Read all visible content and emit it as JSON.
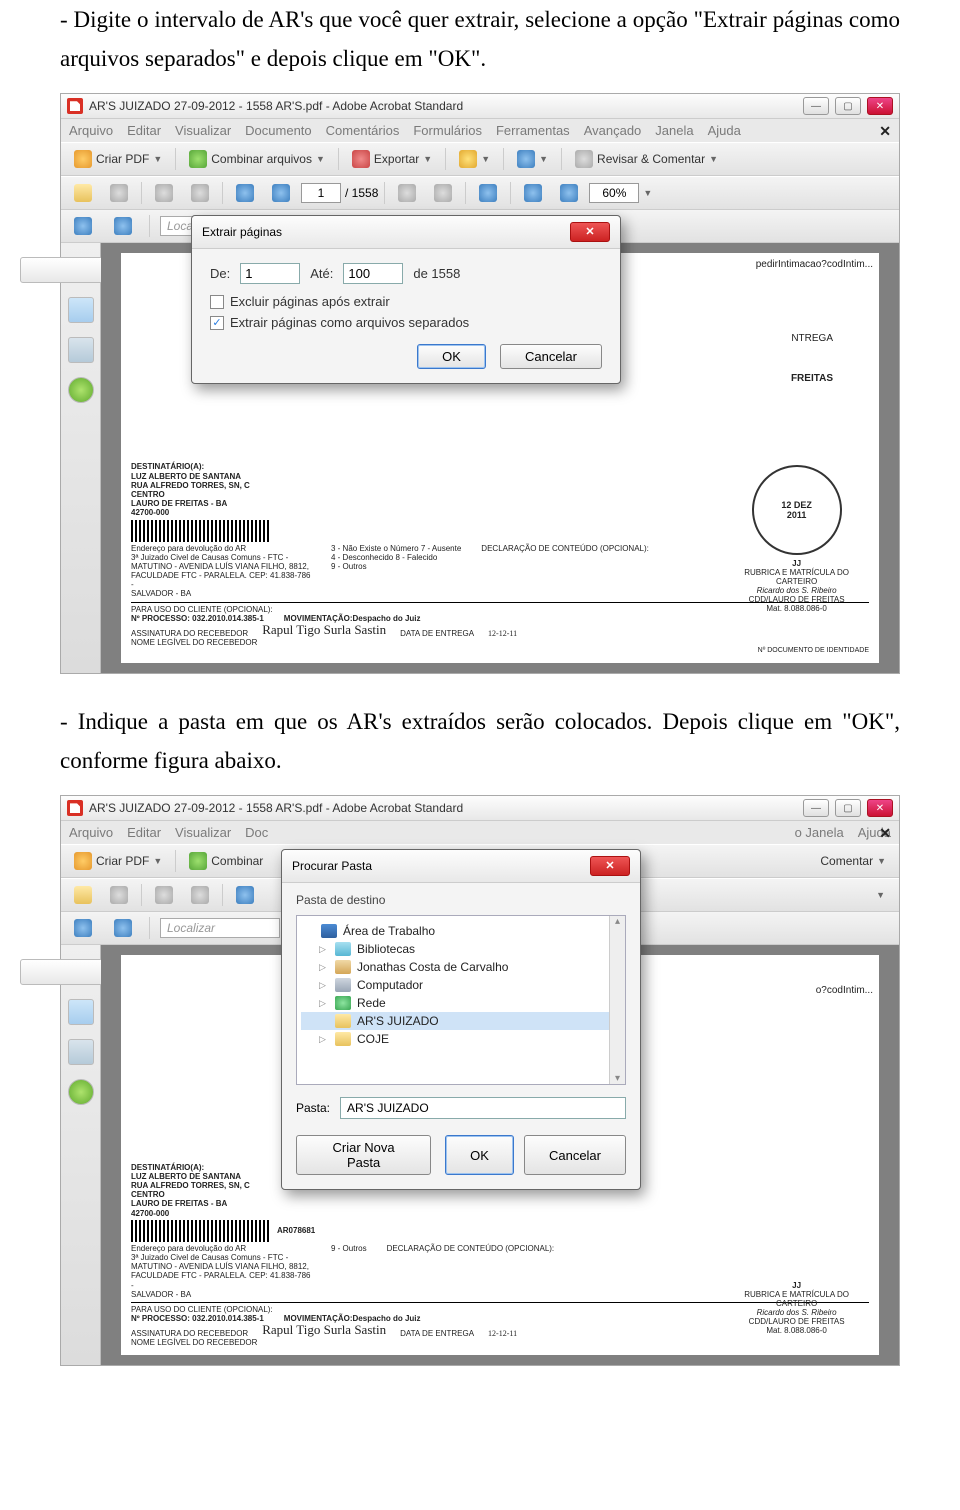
{
  "instructions": {
    "step1": "- Digite o intervalo de AR's que você quer extrair, selecione a opção \"Extrair páginas como arquivos separados\" e depois clique em \"OK\".",
    "step2": "- Indique a pasta em que os AR's extraídos serão colocados. Depois clique em \"OK\", conforme figura abaixo."
  },
  "window": {
    "title": "AR'S JUIZADO 27-09-2012 - 1558 AR'S.pdf - Adobe Acrobat Standard"
  },
  "menu": {
    "items": [
      "Arquivo",
      "Editar",
      "Visualizar",
      "Documento",
      "Comentários",
      "Formulários",
      "Ferramentas",
      "Avançado",
      "Janela",
      "Ajuda"
    ],
    "items_short": [
      "Arquivo",
      "Editar",
      "Visualizar",
      "Doc"
    ],
    "right": "o   Janela"
  },
  "toolbar1": {
    "criar_pdf": "Criar PDF",
    "combinar": "Combinar arquivos",
    "combinar_short": "Combinar",
    "exportar": "Exportar",
    "revisar": "Revisar & Comentar",
    "revisar_short": "Comentar"
  },
  "toolbar_page": {
    "page": "1",
    "total": "/ 1558",
    "zoom": "60%"
  },
  "toolbar2": {
    "localizar": "Localizar"
  },
  "extract_dialog": {
    "title": "Extrair páginas",
    "de_label": "De:",
    "de_value": "1",
    "ate_label": "Até:",
    "ate_value": "100",
    "total": "de 1558",
    "opt1": "Excluir páginas após extrair",
    "opt2": "Extrair páginas como arquivos separados",
    "ok": "OK",
    "cancel": "Cancelar"
  },
  "browse_dialog": {
    "title": "Procurar Pasta",
    "label": "Pasta de destino",
    "tree": [
      {
        "exp": "",
        "icon": "desk",
        "label": "Área de Trabalho"
      },
      {
        "exp": "▷",
        "icon": "lib",
        "label": "Bibliotecas"
      },
      {
        "exp": "▷",
        "icon": "user",
        "label": "Jonathas Costa de Carvalho"
      },
      {
        "exp": "▷",
        "icon": "comp",
        "label": "Computador"
      },
      {
        "exp": "▷",
        "icon": "net",
        "label": "Rede"
      },
      {
        "exp": "",
        "icon": "folder",
        "label": "AR'S JUIZADO",
        "selected": true
      },
      {
        "exp": "▷",
        "icon": "folder",
        "label": "COJE"
      }
    ],
    "pasta_label": "Pasta:",
    "pasta_value": "AR'S JUIZADO",
    "new_folder": "Criar Nova Pasta",
    "ok": "OK",
    "cancel": "Cancelar"
  },
  "pdf_content": {
    "url_frag": "pedirIntimacao?codIntim...",
    "url_frag2": "o?codIntim...",
    "entrega": "NTREGA",
    "freitas": "FREITAS",
    "dest_lines": "DESTINATÁRIO(A):\nLUZ ALBERTO DE SANTANA\nRUA ALFREDO TORRES, SN, C\nCENTRO\nLAURO DE FREITAS - BA",
    "cep": "42700-000",
    "barcode_num": "AR078681",
    "endereco_dev": "Endereço para devolução do AR\n3ª Juizado Civel de Causas Comuns - FTC -\nMATUTINO - AVENIDA LUÍS VIANA FILHO, 8812,\nFACULDADE FTC - PARALELA. CEP: 41.838-786 -\nSALVADOR - BA",
    "declaracao": "DECLARAÇÃO DE CONTEÚDO (OPCIONAL):",
    "options": "3 - Não Existe o Número   7 - Ausente\n4 - Desconhecido   8 - Falecido\n9 - Outros",
    "uso_cliente": "PARA USO DO CLIENTE (OPCIONAL):",
    "processo": "Nº PROCESSO: 032.2010.014.385-1",
    "movimentacao": "MOVIMENTAÇÃO:Despacho do Juiz",
    "assinatura": "ASSINATURA DO RECEBEDOR",
    "sig_text": "Rapul Tigo Surla Sastin",
    "data_entrega": "DATA DE ENTREGA",
    "data_val": "12-12-11",
    "doc_id": "Nº DOCUMENTO DE IDENTIDADE",
    "legivel": "NOME LEGÍVEL DO RECEBEDOR",
    "jj": "JJ",
    "rubrica": "RUBRICA E MATRÍCULA DO\nCARTEIRO",
    "carteiro_name": "Ricardo dos S. Ribeiro",
    "carteiro_loc": "CDD/LAURO DE FREITAS",
    "carteiro_mat": "Mat. 8.088.086-0"
  }
}
